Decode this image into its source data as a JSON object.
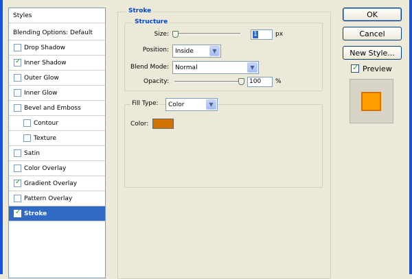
{
  "styles_list": {
    "header": "Styles",
    "blending_options": "Blending Options: Default",
    "items": [
      {
        "label": "Drop Shadow",
        "checked": false
      },
      {
        "label": "Inner Shadow",
        "checked": true
      },
      {
        "label": "Outer Glow",
        "checked": false
      },
      {
        "label": "Inner Glow",
        "checked": false
      },
      {
        "label": "Bevel and Emboss",
        "checked": false
      },
      {
        "label": "Contour",
        "checked": false
      },
      {
        "label": "Texture",
        "checked": false
      },
      {
        "label": "Satin",
        "checked": false
      },
      {
        "label": "Color Overlay",
        "checked": false
      },
      {
        "label": "Gradient Overlay",
        "checked": true
      },
      {
        "label": "Pattern Overlay",
        "checked": false
      },
      {
        "label": "Stroke",
        "checked": true,
        "selected": true
      }
    ]
  },
  "stroke_panel": {
    "title": "Stroke",
    "structure": {
      "title": "Structure",
      "size_label": "Size:",
      "size_value": "1",
      "size_unit": "px",
      "position_label": "Position:",
      "position_value": "Inside",
      "blend_mode_label": "Blend Mode:",
      "blend_mode_value": "Normal",
      "opacity_label": "Opacity:",
      "opacity_value": "100",
      "opacity_unit": "%"
    },
    "fill": {
      "fill_type_label": "Fill Type:",
      "fill_type_value": "Color",
      "color_label": "Color:",
      "color_hex": "#d07300"
    }
  },
  "buttons": {
    "ok": "OK",
    "cancel": "Cancel",
    "new_style": "New Style..."
  },
  "preview": {
    "label": "Preview",
    "checked": true,
    "fill_color": "#ff9d00",
    "stroke_color": "#d07300"
  },
  "icons": {
    "checkbox_check": "check-icon",
    "dropdown": "chevron-down-icon",
    "slider": "slider-thumb-icon"
  }
}
